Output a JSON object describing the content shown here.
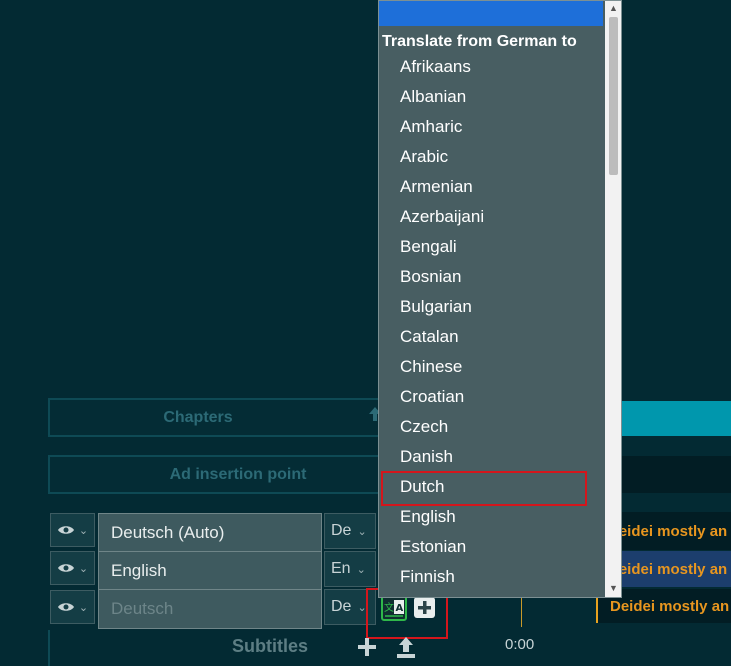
{
  "panels": {
    "chapters_label": "Chapters",
    "ad_insertion_label": "Ad insertion point",
    "subtitles_label": "Subtitles"
  },
  "timeline": {
    "time_label": "0:00",
    "cues": [
      "Deidei mostly an",
      "Deidei mostly an",
      "Deidei mostly an"
    ]
  },
  "tracks": [
    {
      "name": "Deutsch (Auto)",
      "lang": "De"
    },
    {
      "name": "English",
      "lang": "En"
    },
    {
      "name": "",
      "placeholder": "Deutsch",
      "lang": "De"
    }
  ],
  "dropdown": {
    "header": "Translate from German to",
    "selected": "Dutch",
    "items": [
      "Afrikaans",
      "Albanian",
      "Amharic",
      "Arabic",
      "Armenian",
      "Azerbaijani",
      "Bengali",
      "Bosnian",
      "Bulgarian",
      "Catalan",
      "Chinese",
      "Croatian",
      "Czech",
      "Danish",
      "Dutch",
      "English",
      "Estonian",
      "Finnish"
    ]
  },
  "colors": {
    "background": "#032a33",
    "accent": "#0097ad",
    "cue_text": "#e8961f",
    "highlight": "#d4161c",
    "translate_icon": "#2fb84a"
  }
}
